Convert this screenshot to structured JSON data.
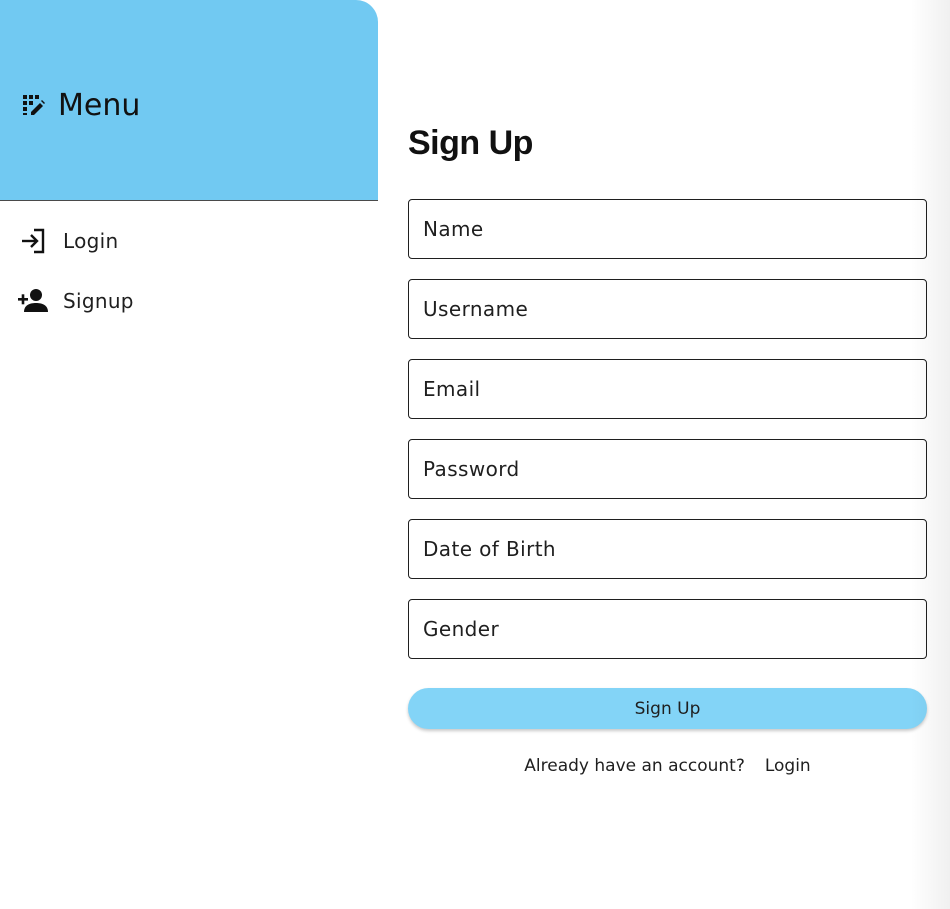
{
  "drawer": {
    "header": {
      "icon": "menu-edit-icon",
      "title": "Menu",
      "color": "#71c9f2"
    },
    "items": [
      {
        "icon": "login-icon",
        "label": "Login"
      },
      {
        "icon": "person-add-icon",
        "label": "Signup"
      }
    ]
  },
  "signup": {
    "title": "Sign Up",
    "fields": {
      "name": {
        "placeholder": "Name",
        "value": ""
      },
      "username": {
        "placeholder": "Username",
        "value": ""
      },
      "email": {
        "placeholder": "Email",
        "value": ""
      },
      "password": {
        "placeholder": "Password",
        "value": ""
      },
      "dob": {
        "placeholder": "Date of Birth",
        "value": ""
      },
      "gender": {
        "placeholder": "Gender",
        "value": ""
      }
    },
    "submit_label": "Sign Up",
    "submit_color": "#83d4f7",
    "footer": {
      "prompt": "Already have an account?",
      "login_label": "Login"
    }
  }
}
